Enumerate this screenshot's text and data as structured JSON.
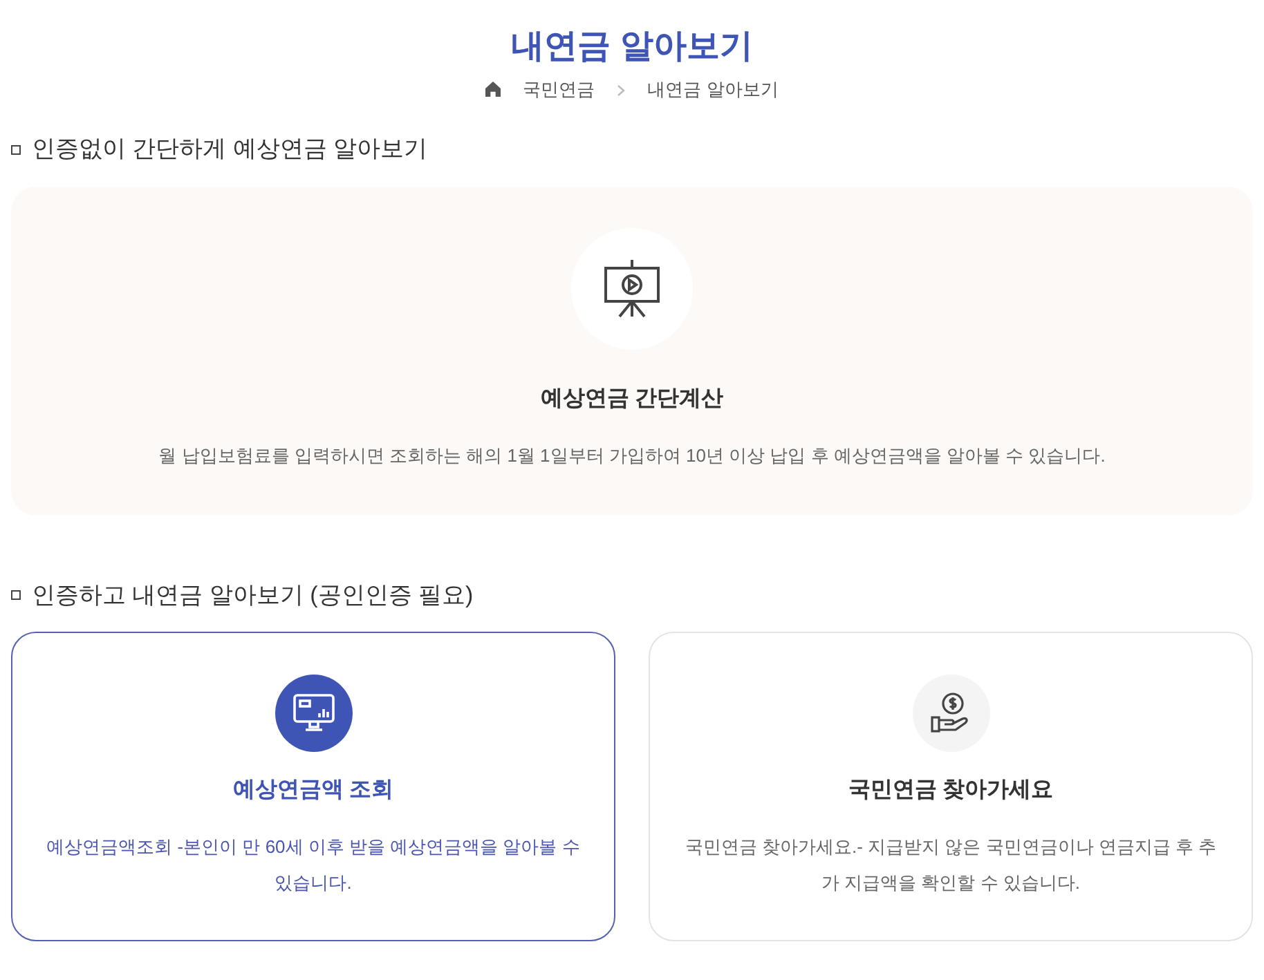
{
  "page_title": "내연금 알아보기",
  "breadcrumb": [
    "국민연금",
    "내연금 알아보기"
  ],
  "sections": [
    {
      "heading": "인증없이 간단하게 예상연금 알아보기",
      "cards": [
        {
          "kind": "wide",
          "title": "예상연금 간단계산",
          "description": "월 납입보험료를 입력하시면 조회하는 해의 1월 1일부터 가입하여 10년 이상 납입 후 예상연금액을 알아볼 수 있습니다.",
          "selected": false
        }
      ]
    },
    {
      "heading": "인증하고 내연금 알아보기 (공인인증 필요)",
      "cards": [
        {
          "kind": "half",
          "title": "예상연금액 조회",
          "description": "예상연금액조회 -본인이 만 60세 이후 받을 예상연금액을 알아볼 수 있습니다.",
          "selected": true
        },
        {
          "kind": "half",
          "title": "국민연금 찾아가세요",
          "description": "국민연금 찾아가세요.- 지급받지 않은 국민연금이나 연금지급 후 추가 지급액을 확인할 수 있습니다.",
          "selected": false
        }
      ]
    }
  ]
}
